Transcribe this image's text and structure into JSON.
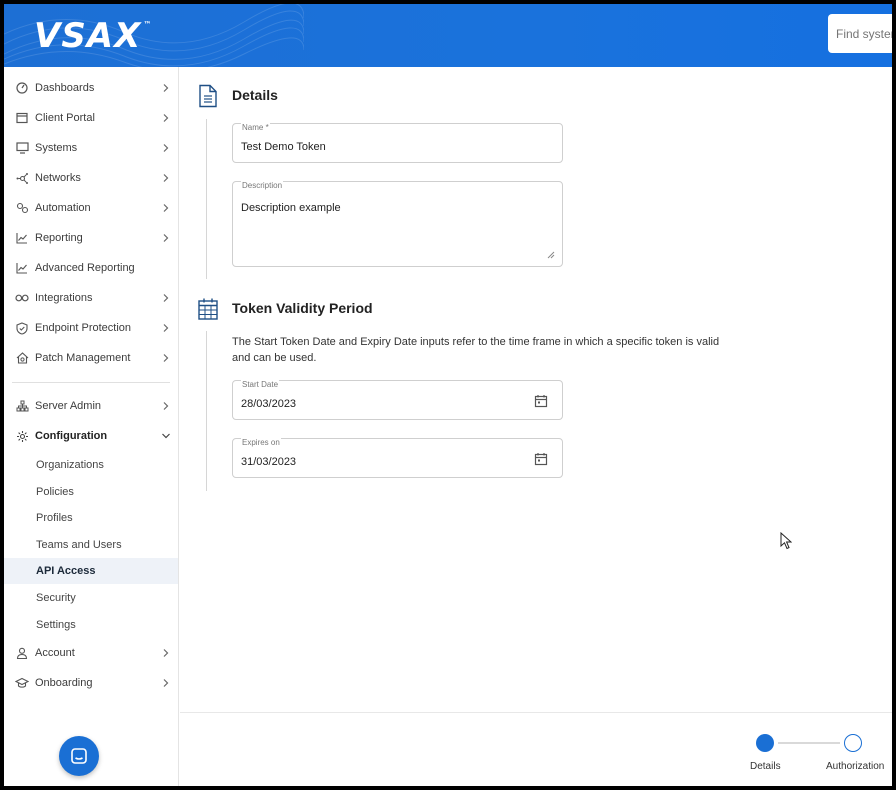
{
  "header": {
    "logo": "VSAX",
    "logo_tm": "™",
    "search_placeholder": "Find systems"
  },
  "sidebar": {
    "items": [
      {
        "label": "Dashboards",
        "icon": "dashboard-gauge-icon"
      },
      {
        "label": "Client Portal",
        "icon": "window-icon"
      },
      {
        "label": "Systems",
        "icon": "monitor-icon"
      },
      {
        "label": "Networks",
        "icon": "network-icon"
      },
      {
        "label": "Automation",
        "icon": "gears-icon"
      },
      {
        "label": "Reporting",
        "icon": "line-chart-icon"
      },
      {
        "label": "Advanced Reporting",
        "icon": "line-chart-icon"
      },
      {
        "label": "Integrations",
        "icon": "infinity-icon"
      },
      {
        "label": "Endpoint Protection",
        "icon": "shield-icon"
      },
      {
        "label": "Patch Management",
        "icon": "home-gear-icon"
      },
      {
        "label": "Server Admin",
        "icon": "hierarchy-icon"
      },
      {
        "label": "Configuration",
        "icon": "gear-icon"
      }
    ],
    "sub_items": [
      "Organizations",
      "Policies",
      "Profiles",
      "Teams and Users",
      "API Access",
      "Security",
      "Settings"
    ],
    "bottom_items": [
      {
        "label": "Account",
        "icon": "user-icon"
      },
      {
        "label": "Onboarding",
        "icon": "graduation-cap-icon"
      }
    ]
  },
  "details": {
    "title": "Details",
    "name_label": "Name *",
    "name_value": "Test Demo Token",
    "description_label": "Description",
    "description_value": "Description example"
  },
  "validity": {
    "title": "Token Validity Period",
    "helper": "The Start Token Date and Expiry Date inputs refer to the time frame in which a specific token is valid and can be used.",
    "start_label": "Start Date",
    "start_value": "28/03/2023",
    "expires_label": "Expires on",
    "expires_value": "31/03/2023"
  },
  "stepper": {
    "steps": [
      "Details",
      "Authorization"
    ],
    "active_step": 0
  },
  "colors": {
    "brand": "#1a6fd4",
    "active_nav_bg": "#eef2f8"
  }
}
